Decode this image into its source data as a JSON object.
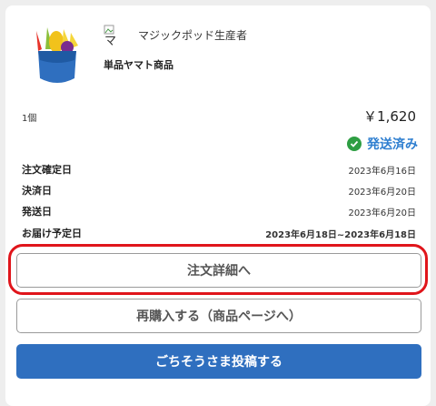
{
  "producer": {
    "name": "マジックポッド生産者",
    "icon_alt": "マ"
  },
  "product": {
    "name": "単品ヤマト商品"
  },
  "order": {
    "quantity": "1個",
    "price": "￥1,620",
    "status": "発送済み",
    "status_color": "#2f7fd0"
  },
  "details": [
    {
      "label": "注文確定日",
      "value": "2023年6月16日"
    },
    {
      "label": "決済日",
      "value": "2023年6月20日"
    },
    {
      "label": "発送日",
      "value": "2023年6月20日"
    },
    {
      "label": "お届け予定日",
      "value": "2023年6月18日~2023年6月18日"
    }
  ],
  "buttons": {
    "order_detail": "注文詳細へ",
    "repurchase": "再購入する（商品ページへ）",
    "post": "ごちそうさま投稿する"
  },
  "colors": {
    "primary": "#2f6fbf",
    "highlight": "#e0151b",
    "success": "#2e9e43"
  }
}
